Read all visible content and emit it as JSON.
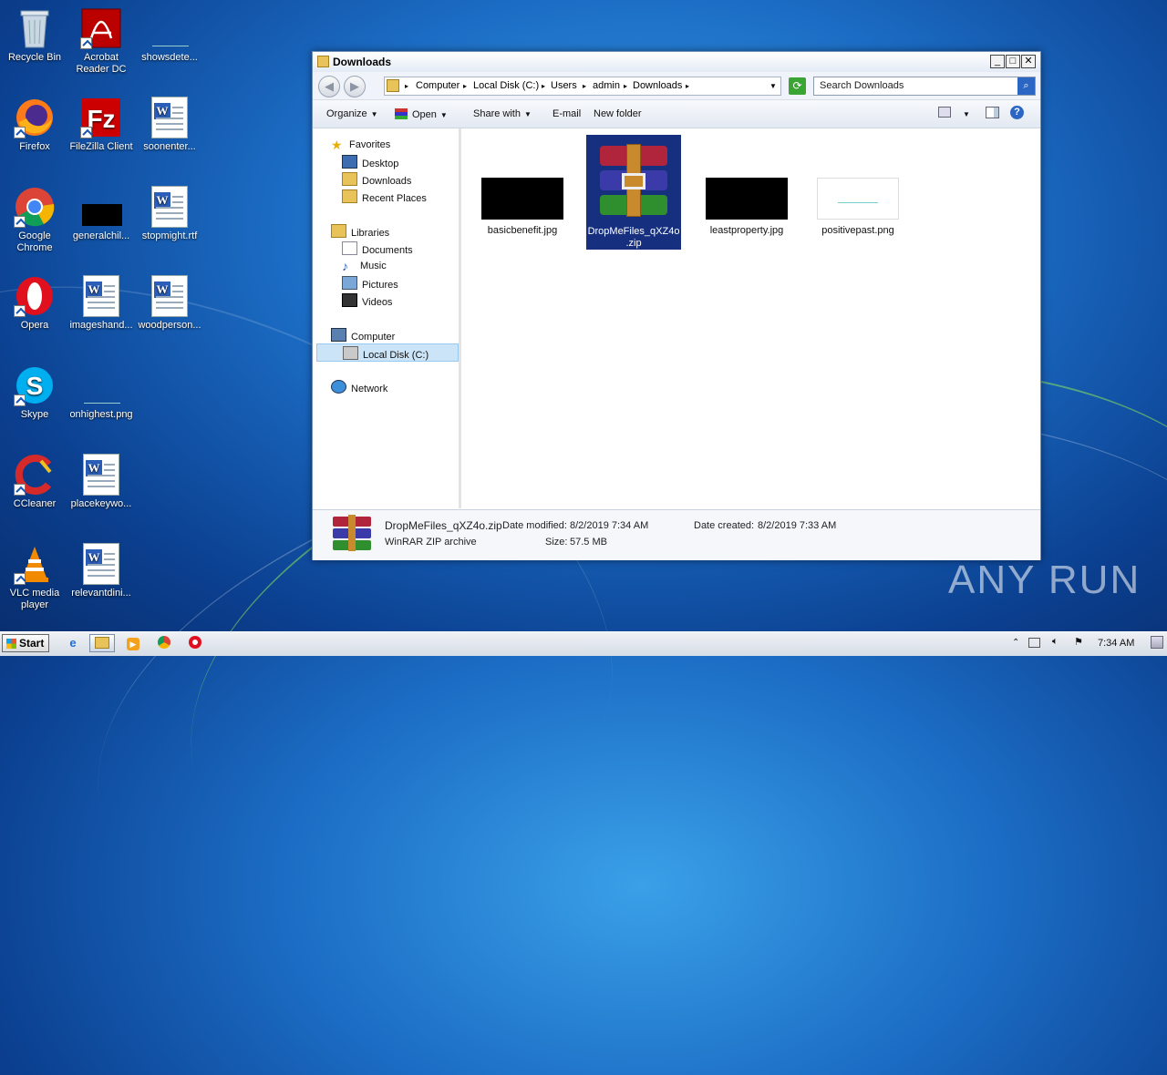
{
  "desktop": {
    "icons": [
      {
        "label": "Recycle Bin"
      },
      {
        "label": "Acrobat Reader DC"
      },
      {
        "label": "showsdete..."
      },
      {
        "label": "Firefox"
      },
      {
        "label": "FileZilla Client"
      },
      {
        "label": "soonenter..."
      },
      {
        "label": "Google Chrome"
      },
      {
        "label": "generalchil..."
      },
      {
        "label": "stopmight.rtf"
      },
      {
        "label": "Opera"
      },
      {
        "label": "imageshand..."
      },
      {
        "label": "woodperson..."
      },
      {
        "label": "Skype"
      },
      {
        "label": "onhighest.png"
      },
      {
        "label": "CCleaner"
      },
      {
        "label": "placekeywo..."
      },
      {
        "label": "VLC media player"
      },
      {
        "label": "relevantdini..."
      }
    ]
  },
  "window": {
    "title": "Downloads",
    "controls": {
      "minimize": "_",
      "maximize": "□",
      "close": "✕"
    },
    "breadcrumb": [
      "Computer",
      "Local Disk (C:)",
      "Users",
      "admin",
      "Downloads"
    ],
    "search_placeholder": "Search Downloads",
    "toolbar": {
      "organize": "Organize",
      "open": "Open",
      "share_with": "Share with",
      "email": "E-mail",
      "new_folder": "New folder"
    },
    "nav": {
      "favorites": "Favorites",
      "desktop": "Desktop",
      "downloads": "Downloads",
      "recent_places": "Recent Places",
      "libraries": "Libraries",
      "documents": "Documents",
      "music": "Music",
      "pictures": "Pictures",
      "videos": "Videos",
      "computer": "Computer",
      "local_disk": "Local Disk (C:)",
      "network": "Network"
    },
    "files": [
      {
        "name": "basicbenefit.jpg"
      },
      {
        "name": "DropMeFiles_qXZ4o.zip",
        "name_line1": "DropMeFiles_qXZ4o",
        "name_line2": ".zip",
        "selected": true
      },
      {
        "name": "leastproperty.jpg"
      },
      {
        "name": "positivepast.png"
      }
    ],
    "details": {
      "filename": "DropMeFiles_qXZ4o.zip",
      "type": "WinRAR ZIP archive",
      "date_modified_label": "Date modified:",
      "date_modified": "8/2/2019 7:34 AM",
      "date_created_label": "Date created:",
      "date_created": "8/2/2019 7:33 AM",
      "size_label": "Size:",
      "size": "57.5 MB"
    }
  },
  "taskbar": {
    "start": "Start",
    "clock": "7:34 AM"
  },
  "watermark": "ANY RUN"
}
